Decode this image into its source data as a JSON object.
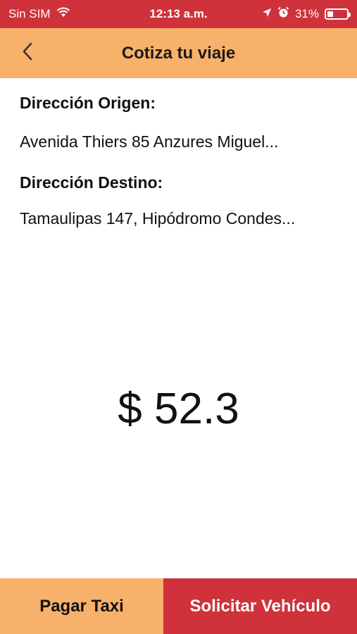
{
  "status_bar": {
    "carrier": "Sin SIM",
    "time": "12:13 a.m.",
    "battery_percent": "31%",
    "battery_level": 0.31,
    "icons": [
      "wifi-icon",
      "location-arrow-icon",
      "alarm-icon",
      "battery-icon"
    ],
    "background": "#cf323a"
  },
  "nav": {
    "title": "Cotiza tu viaje",
    "back_icon": "chevron-left-icon",
    "background": "#f8b16a"
  },
  "trip": {
    "origin_label": "Dirección Origen:",
    "origin_value": "Avenida Thiers 85 Anzures Miguel...",
    "destination_label": "Dirección Destino:",
    "destination_value": "Tamaulipas 147, Hipódromo Condes..."
  },
  "quote": {
    "price": "$ 52.3"
  },
  "actions": {
    "pay_label": "Pagar Taxi",
    "request_label": "Solicitar Vehículo",
    "pay_color": "#f8b16a",
    "request_color": "#cf323a"
  }
}
